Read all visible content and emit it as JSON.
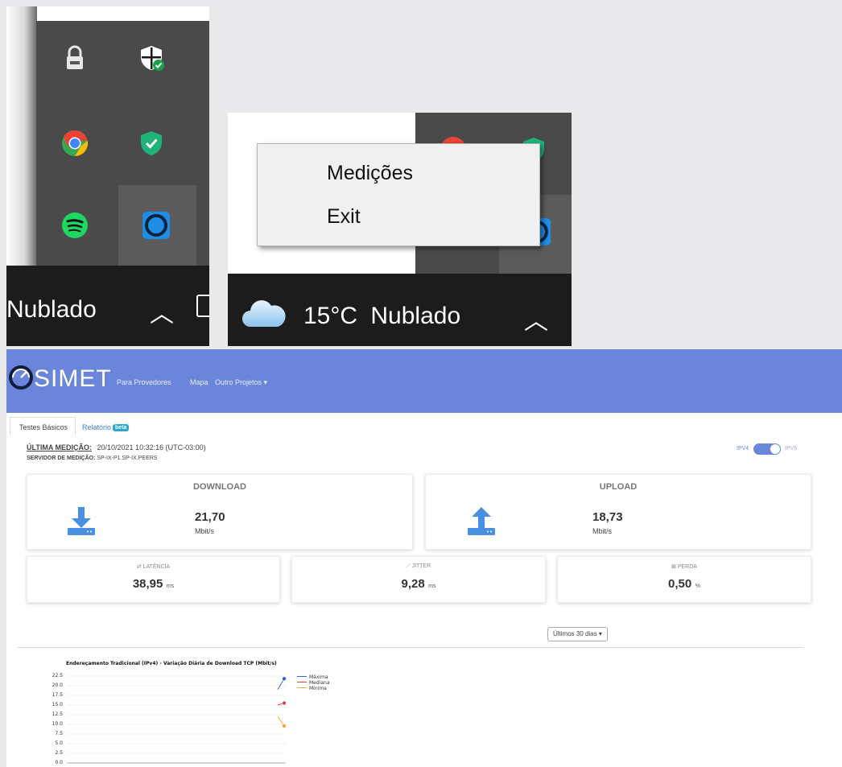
{
  "tray_a": {
    "taskbar_text": "Nublado"
  },
  "tray_b": {
    "menu": {
      "items": [
        "Medições",
        "Exit"
      ]
    },
    "taskbar": {
      "temperature": "15°C",
      "condition": "Nublado"
    }
  },
  "simet": {
    "logo": "SIMET",
    "nav": [
      "Para Provedores",
      "Mapa",
      "Outro Projetos"
    ],
    "tabs": {
      "basic": "Testes Básicos",
      "report": "Relatório",
      "beta": "beta"
    },
    "last_measure": {
      "label": "ÚLTIMA MEDIÇÃO:",
      "value": "20/10/2021 10:32:16 (UTC-03:00)"
    },
    "server": {
      "label": "SERVIDOR DE MEDIÇÃO:",
      "value": "SP-IX-P1.SP-IX.PEERS"
    },
    "ip_toggle": {
      "left": "IPV4",
      "right": "IPV6"
    },
    "download": {
      "title": "DOWNLOAD",
      "value": "21,70",
      "unit": "Mbit/s"
    },
    "upload": {
      "title": "UPLOAD",
      "value": "18,73",
      "unit": "Mbit/s"
    },
    "latency": {
      "title": "LATÊNCIA",
      "value": "38,95",
      "unit": "ms"
    },
    "jitter": {
      "title": "JITTER",
      "value": "9,28",
      "unit": "ms"
    },
    "loss": {
      "title": "PERDA",
      "value": "0,50",
      "unit": "%"
    },
    "period": "Últimos 30 dias",
    "colors": {
      "header": "#6a85d9",
      "accent": "#2aa7c9",
      "icon": "#4a90e2"
    }
  },
  "chart_data": {
    "type": "line",
    "title": "Endereçamento Tradicional (IPv4) - Variação Diária de Download TCP (Mbit/s)",
    "ylim": [
      0,
      22.5
    ],
    "yticks": [
      "22.5",
      "20.0",
      "17.5",
      "15.0",
      "12.5",
      "10.0",
      "7.5",
      "5.0",
      "2.5",
      "0.0"
    ],
    "grid": true,
    "legend_position": "right",
    "series": [
      {
        "name": "Máxima",
        "color": "#3b5fd6",
        "values": [
          19.0,
          21.8
        ]
      },
      {
        "name": "Mediana",
        "color": "#e04545",
        "values": [
          15.0,
          15.5
        ]
      },
      {
        "name": "Mínima",
        "color": "#f0a830",
        "values": [
          12.0,
          9.6
        ]
      }
    ]
  }
}
